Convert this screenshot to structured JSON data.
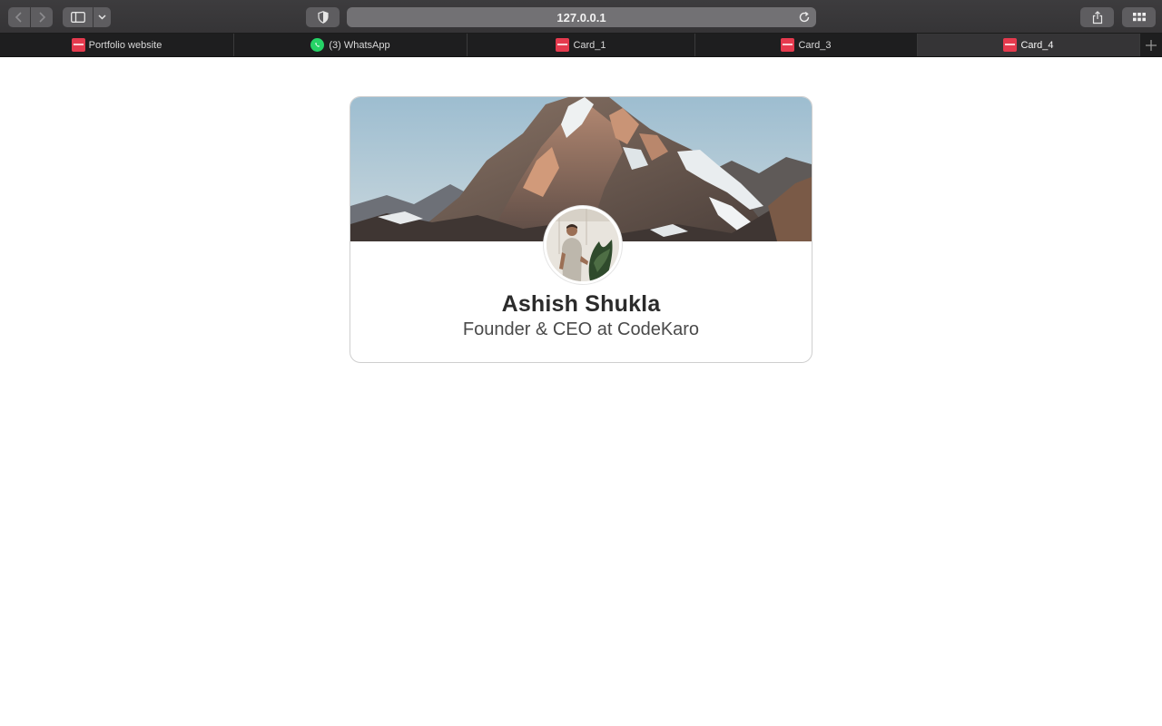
{
  "browser": {
    "url": "127.0.0.1",
    "tabs": [
      {
        "label": "Portfolio website",
        "favicon": "codekaro-favicon-icon",
        "active": false
      },
      {
        "label": "(3) WhatsApp",
        "favicon": "whatsapp-icon",
        "active": false
      },
      {
        "label": "Card_1",
        "favicon": "codekaro-favicon-icon",
        "active": false
      },
      {
        "label": "Card_3",
        "favicon": "codekaro-favicon-icon",
        "active": false
      },
      {
        "label": "Card_4",
        "favicon": "codekaro-favicon-icon",
        "active": true
      }
    ],
    "icons": {
      "back": "chevron-left-icon",
      "forward": "chevron-right-icon",
      "sidebar": "sidebar-icon",
      "sidebar_menu": "chevron-down-icon",
      "privacy": "shield-icon",
      "reload": "reload-icon",
      "share": "share-icon",
      "tab_overview": "grid-icon",
      "new_tab": "plus-icon"
    }
  },
  "profile_card": {
    "name": "Ashish Shukla",
    "role": "Founder & CEO at CodeKaro",
    "cover_image": "mountain-landscape",
    "avatar_image": "profile-photo"
  },
  "colors": {
    "favicon_red": "#e53a4e",
    "whatsapp_green": "#25d366",
    "name_text": "#2b2b2b",
    "role_text": "#4a4a4a",
    "card_border": "#cfcfcf"
  }
}
